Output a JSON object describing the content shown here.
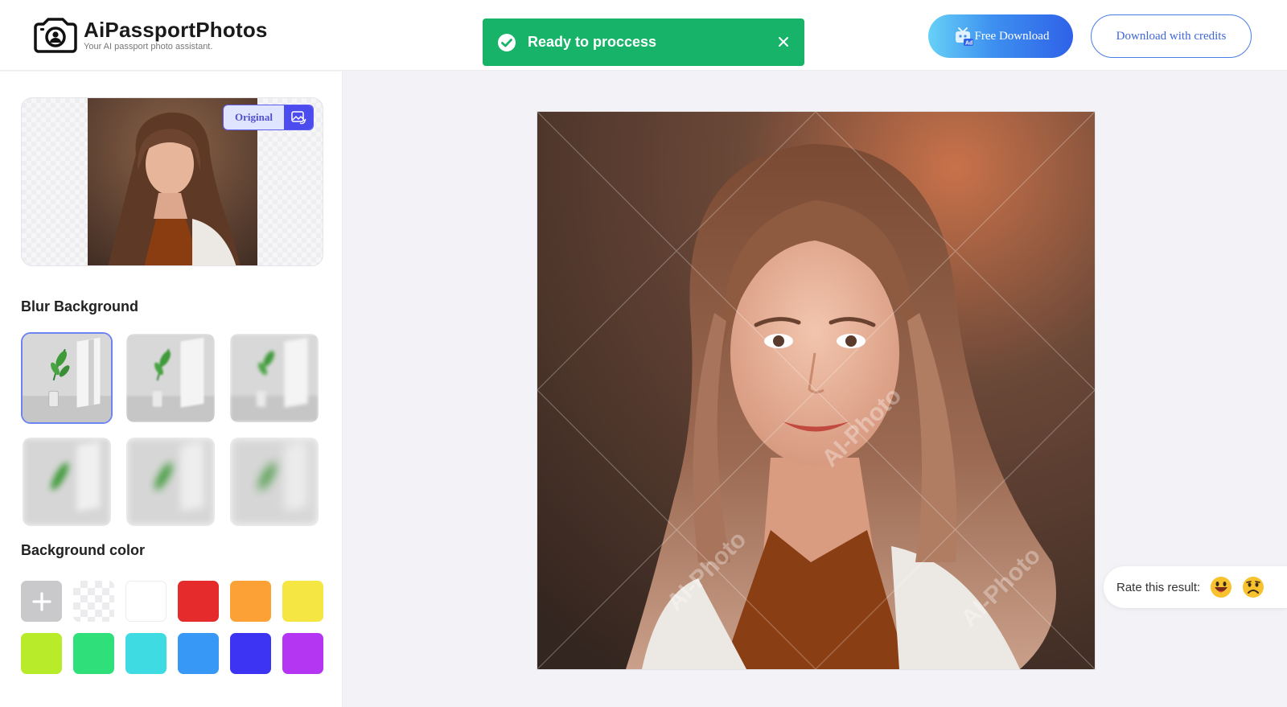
{
  "header": {
    "logo_title": "AiPassportPhotos",
    "logo_subtitle": "Your AI passport photo assistant.",
    "toast_message": "Ready to proccess",
    "free_download_label": "Free Download",
    "download_credits_label": "Download with credits"
  },
  "sidebar": {
    "original_label": "Original",
    "blur_title": "Blur Background",
    "blur_levels": [
      1,
      2,
      3,
      4,
      5,
      6
    ],
    "selected_blur_index": 0,
    "color_title": "Background color",
    "colors": [
      "add",
      "transparent",
      "#ffffff",
      "#e52b2b",
      "#fba135",
      "#f5e643",
      "#b8ec2a",
      "#2fe07a",
      "#3edbe2",
      "#3798f6",
      "#3c34f2",
      "#b536f2"
    ]
  },
  "main": {
    "watermark_text": "AI-Photo"
  },
  "rating": {
    "label": "Rate this result:",
    "options": [
      "happy-emoji-icon",
      "sad-emoji-icon"
    ]
  },
  "colors": {
    "toast_green": "#16b368",
    "accent_blue": "#3f66d8",
    "selected_border": "#6d83f0"
  }
}
